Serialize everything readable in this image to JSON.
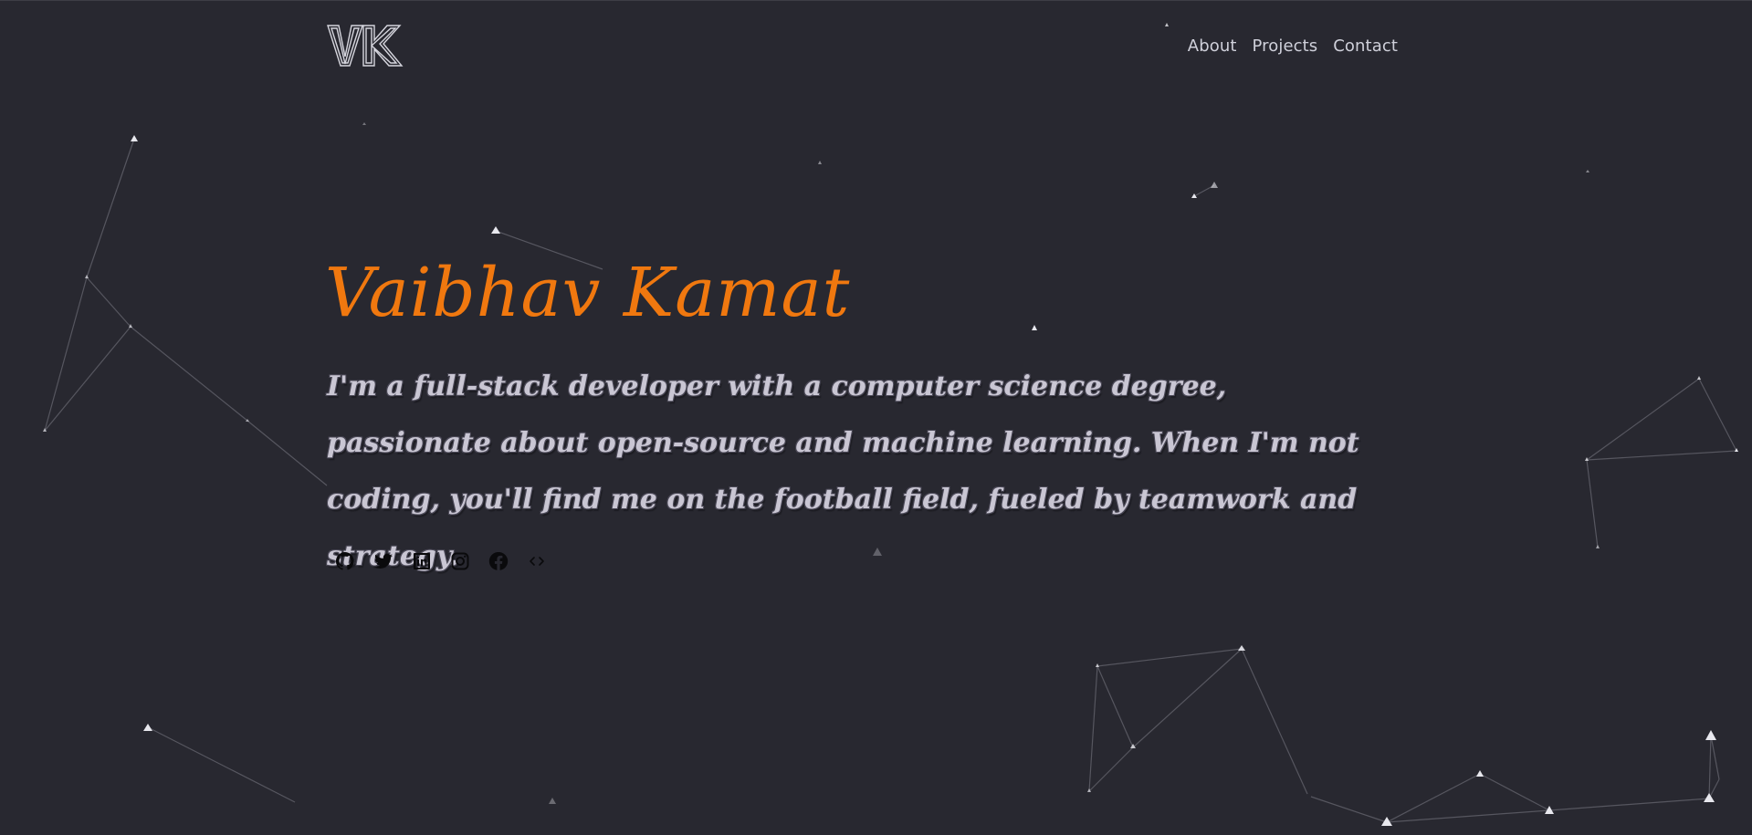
{
  "logo": {
    "text": "VK"
  },
  "nav": {
    "items": [
      {
        "label": "About"
      },
      {
        "label": "Projects"
      },
      {
        "label": "Contact"
      }
    ]
  },
  "hero": {
    "name": "Vaibhav Kamat",
    "bio": "I'm a full-stack developer with a computer science degree, passionate about open-source and machine learning. When I'm not coding, you'll find me on the football field, fueled by teamwork and strategy."
  },
  "social": {
    "icons": [
      "github-icon",
      "twitter-icon",
      "linkedin-icon",
      "instagram-icon",
      "facebook-icon",
      "code-icon"
    ]
  },
  "colors": {
    "background": "#282830",
    "accent": "#f0780f",
    "text": "#c9c6d3",
    "nav": "#cfd0da"
  }
}
